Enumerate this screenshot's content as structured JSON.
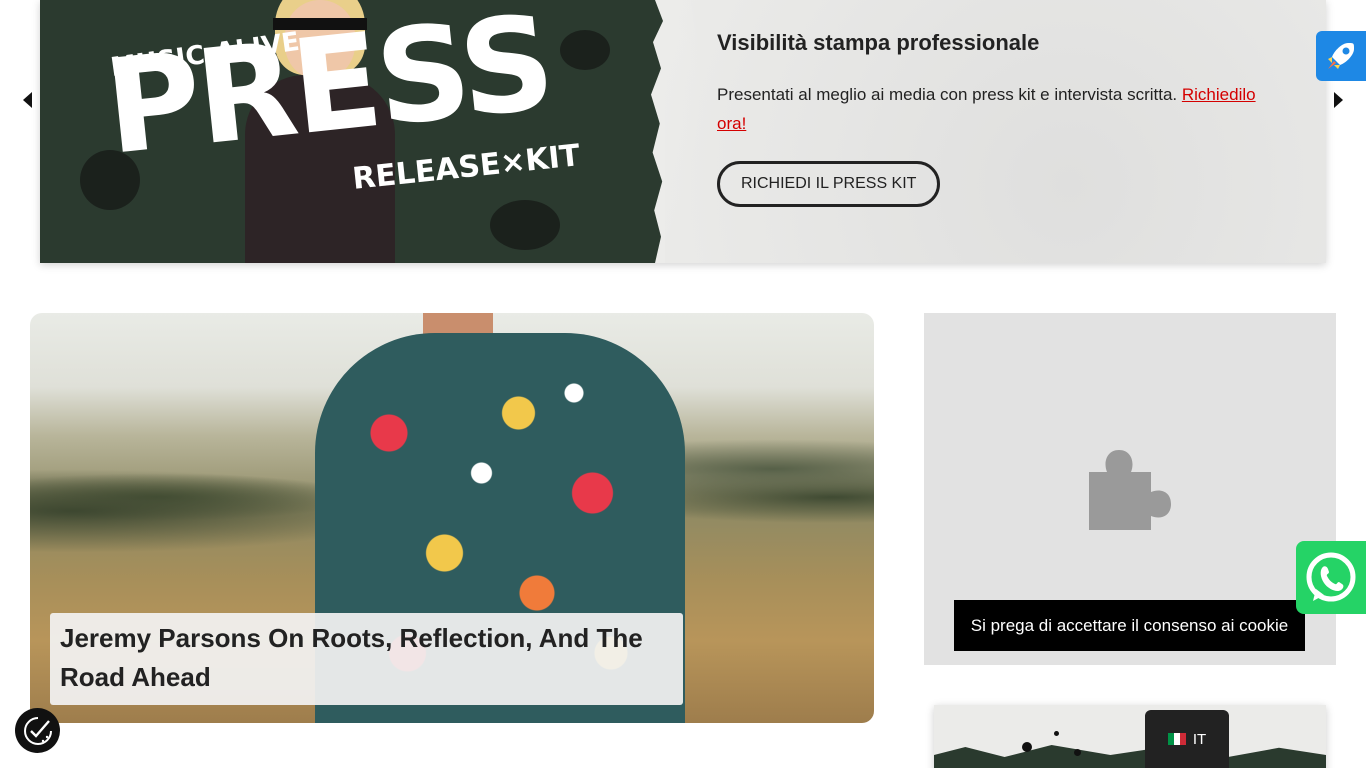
{
  "slider": {
    "image": {
      "top_text": "MUSIC-ALIVE",
      "main_text": "PRESS",
      "bottom_text": "RELEASE×KIT"
    },
    "title": "Visibilità stampa professionale",
    "description": "Presentati al meglio ai media con press kit e intervista scritta.",
    "link_text": "Richiedilo ora!",
    "button_label": "RICHIEDI IL PRESS KIT"
  },
  "article": {
    "title": "Jeremy Parsons On Roots, Reflection, And The Road Ahead"
  },
  "sidebar": {
    "consent_button": "Si prega di accettare il consenso ai cookie"
  },
  "language": {
    "code": "IT"
  },
  "icons": {
    "slider_prev": "chevron-left-icon",
    "slider_next": "chevron-right-icon",
    "rocket": "rocket-icon",
    "puzzle": "puzzle-icon",
    "whatsapp": "whatsapp-icon",
    "privacy": "privacy-check-icon",
    "flag": "italy-flag-icon"
  },
  "colors": {
    "link": "#d40000",
    "rocket_bg": "#1e88e5",
    "whatsapp_bg": "#25d366",
    "consent_bg": "#000000"
  }
}
